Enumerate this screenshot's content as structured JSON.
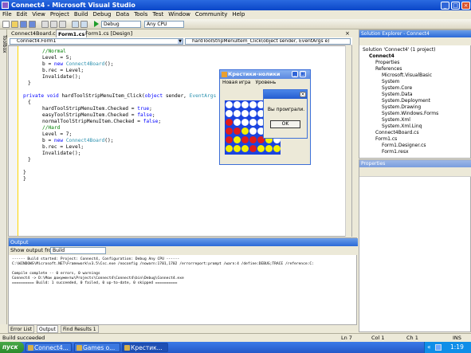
{
  "window": {
    "title": "Connect4 - Microsoft Visual Studio"
  },
  "menu": [
    "File",
    "Edit",
    "View",
    "Project",
    "Build",
    "Debug",
    "Data",
    "Tools",
    "Test",
    "Window",
    "Community",
    "Help"
  ],
  "toolbar": {
    "debug_label": "Debug",
    "platform_label": "Any CPU"
  },
  "toolbox": {
    "label": "Toolbox"
  },
  "doc_tabs": [
    "Connect4Board.cs",
    "Form1.cs",
    "Form1.cs [Design]"
  ],
  "nav": {
    "class": "Connect4.Form1",
    "member": "hardToolStripMenuItem_Click(object sender, EventArgs e)"
  },
  "code_lines": [
    "//Normal",
    "Level = 5;",
    "b = new Connect4Board();",
    "b.rec = Level;",
    "Invalidate();",
    "}",
    "",
    "private void hardToolStripMenuItem_Click(object sender, EventArgs e",
    "{",
    "hardToolStripMenuItem.Checked = true;",
    "easyToolStripMenuItem.Checked = false;",
    "normalToolStripMenuItem.Checked = false;",
    "//Hard",
    "Level = 7;",
    "b = new Connect4Board();",
    "b.rec = Level;",
    "Invalidate();",
    "}",
    "",
    "}",
    "}"
  ],
  "output": {
    "title": "Output",
    "show_from_label": "Show output from:",
    "show_from_value": "Build",
    "lines": [
      "------ Build started: Project: Connect4, Configuration: Debug Any CPU ------",
      "C:\\WINDOWS\\Microsoft.NET\\Framework\\v3.5\\Csc.exe /noconfig /nowarn:1701,1702 /errorreport:prompt /warn:4 /define:DEBUG;TRACE /reference:C:",
      "",
      "Compile complete -- 0 errors, 0 warnings",
      "Connect4 -> D:\\Мои документы\\Projects\\Connect4\\Connect4\\bin\\Debug\\Connect4.exe",
      "========== Build: 1 succeeded, 0 failed, 0 up-to-date, 0 skipped =========="
    ]
  },
  "bottom_tabs": [
    "Error List",
    "Output",
    "Find Results 1"
  ],
  "solution_explorer": {
    "title": "Solution Explorer - Connect4",
    "items": [
      {
        "label": "Solution 'Connect4' (1 project)",
        "indent": 0
      },
      {
        "label": "Connect4",
        "indent": 1,
        "bold": true
      },
      {
        "label": "Properties",
        "indent": 2
      },
      {
        "label": "References",
        "indent": 2
      },
      {
        "label": "Microsoft.VisualBasic",
        "indent": 3
      },
      {
        "label": "System",
        "indent": 3
      },
      {
        "label": "System.Core",
        "indent": 3
      },
      {
        "label": "System.Data",
        "indent": 3
      },
      {
        "label": "System.Deployment",
        "indent": 3
      },
      {
        "label": "System.Drawing",
        "indent": 3
      },
      {
        "label": "System.Windows.Forms",
        "indent": 3
      },
      {
        "label": "System.Xml",
        "indent": 3
      },
      {
        "label": "System.Xml.Linq",
        "indent": 3
      },
      {
        "label": "Connect4Board.cs",
        "indent": 2
      },
      {
        "label": "Form1.cs",
        "indent": 2
      },
      {
        "label": "Form1.Designer.cs",
        "indent": 3
      },
      {
        "label": "Form1.resx",
        "indent": 3
      }
    ]
  },
  "properties": {
    "title": "Properties"
  },
  "status": {
    "text": "Build succeeded",
    "ln": "Ln 7",
    "col": "Col 1",
    "ch": "Ch 1",
    "ins": "INS"
  },
  "taskbar": {
    "start": "пуск",
    "tasks": [
      "Connect4...",
      "Games o...",
      "Крестик..."
    ],
    "clock": "1:19"
  },
  "game": {
    "title": "Крестики-нолики",
    "menu": [
      "Новая игра",
      "Уровень"
    ],
    "board": [
      [
        "w",
        "w",
        "w",
        "w",
        "w",
        "w",
        "w"
      ],
      [
        "w",
        "w",
        "w",
        "w",
        "w",
        "w",
        "w"
      ],
      [
        "r",
        "w",
        "w",
        "w",
        "w",
        "w",
        "w"
      ],
      [
        "r",
        "r",
        "y",
        "w",
        "w",
        "w",
        "w"
      ],
      [
        "r",
        "y",
        "r",
        "r",
        "r",
        "y",
        "w"
      ],
      [
        "y",
        "y",
        "y",
        "r",
        "y",
        "y",
        "y"
      ]
    ]
  },
  "dialog": {
    "text": "Вы проиграли.",
    "ok": "OK"
  },
  "colors": {
    "red": "#e11b1b",
    "yellow": "#f4f000",
    "white": "#ffffff",
    "board_blue": "#1b44e0"
  }
}
